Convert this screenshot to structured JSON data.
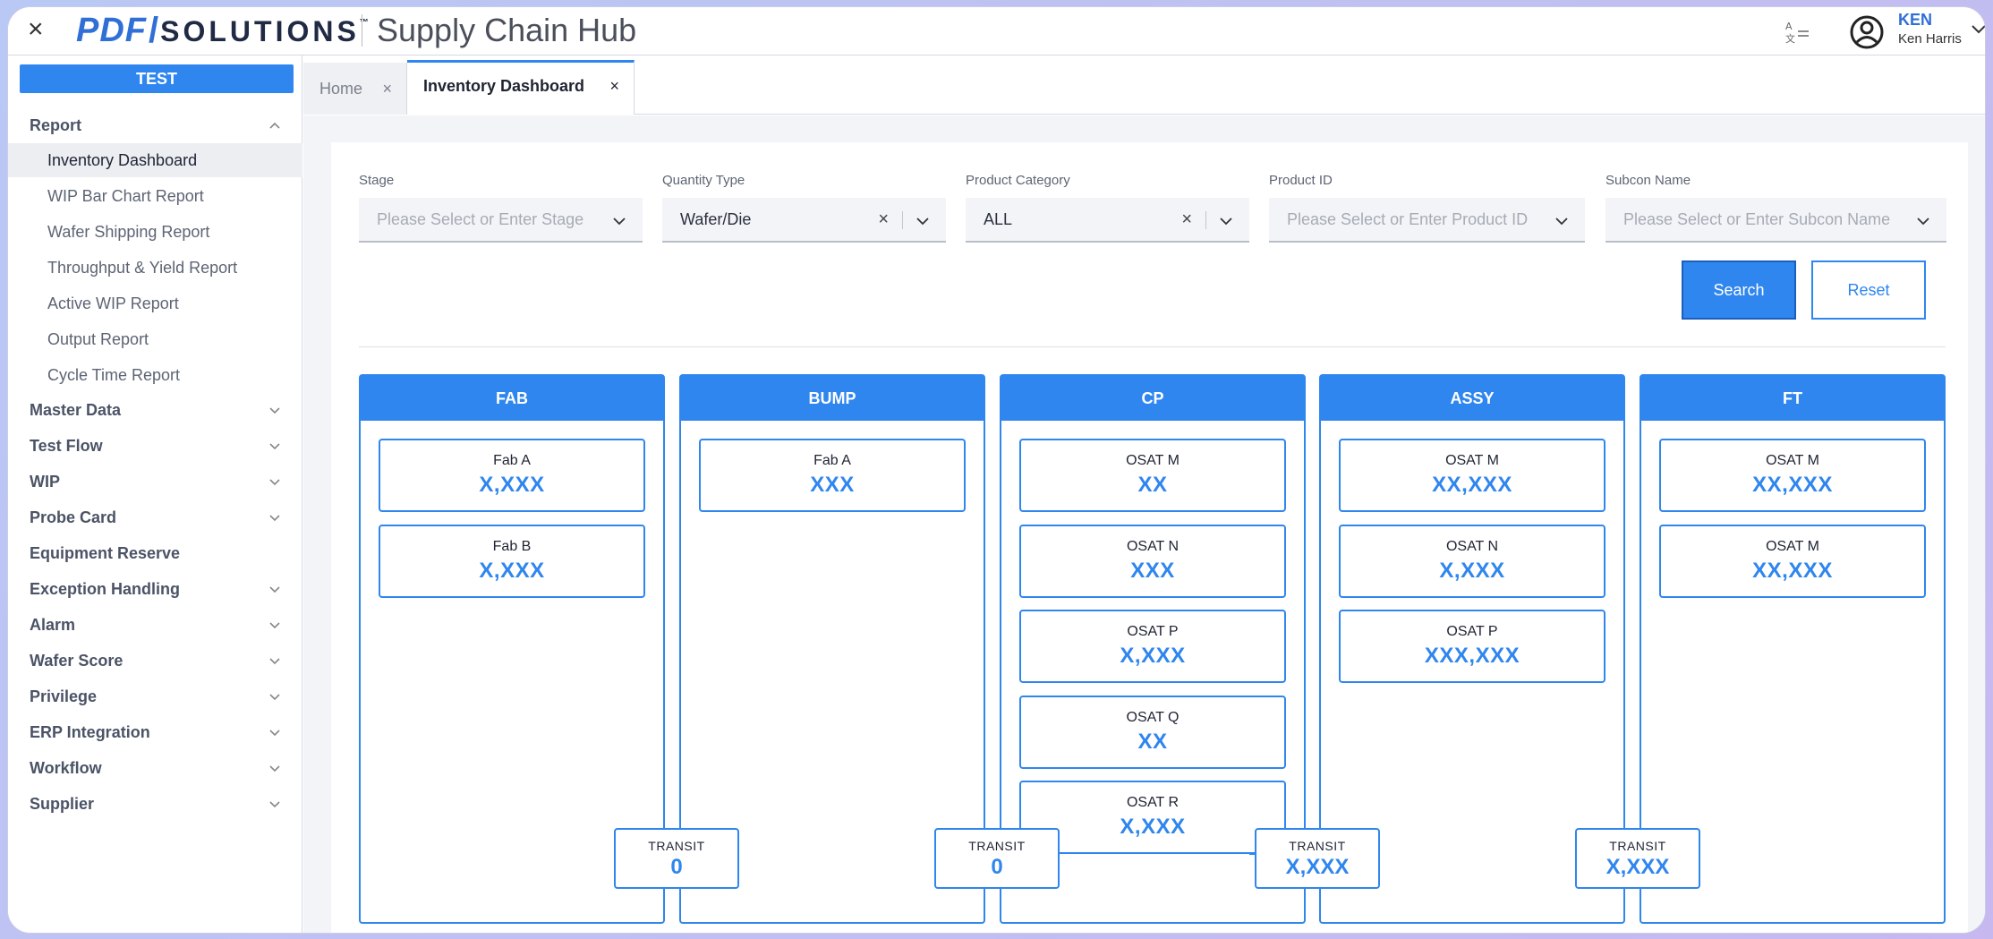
{
  "header": {
    "close_glyph": "×",
    "logo_pdf": "PDF",
    "logo_slash": "/",
    "logo_solutions": "SOLUTIONS",
    "logo_tm": "™",
    "app_title": "Supply Chain Hub",
    "user_short": "KEN",
    "user_full": "Ken Harris"
  },
  "sidebar": {
    "env_badge": "TEST",
    "report_section": "Report",
    "report_items": [
      "Inventory Dashboard",
      "WIP Bar Chart Report",
      "Wafer Shipping Report",
      "Throughput & Yield Report",
      "Active WIP Report",
      "Output Report",
      "Cycle Time Report"
    ],
    "sections": [
      "Master Data",
      "Test Flow",
      "WIP",
      "Probe Card",
      "Equipment Reserve",
      "Exception Handling",
      "Alarm",
      "Wafer Score",
      "Privilege",
      "ERP Integration",
      "Workflow",
      "Supplier"
    ]
  },
  "tabs": [
    {
      "label": "Home",
      "close": "×"
    },
    {
      "label": "Inventory Dashboard",
      "close": "×"
    }
  ],
  "filters": {
    "stage": {
      "label": "Stage",
      "placeholder": "Please Select or Enter Stage"
    },
    "quantity_type": {
      "label": "Quantity Type",
      "value": "Wafer/Die"
    },
    "product_category": {
      "label": "Product Category",
      "value": "ALL"
    },
    "product_id": {
      "label": "Product ID",
      "placeholder": "Please Select or Enter Product ID"
    },
    "subcon_name": {
      "label": "Subcon Name",
      "placeholder": "Please Select or Enter Subcon Name"
    },
    "clear_glyph": "×"
  },
  "buttons": {
    "search": "Search",
    "reset": "Reset"
  },
  "stages": [
    {
      "name": "FAB",
      "cards": [
        {
          "site": "Fab A",
          "qty": "X,XXX"
        },
        {
          "site": "Fab B",
          "qty": "X,XXX"
        }
      ]
    },
    {
      "name": "BUMP",
      "cards": [
        {
          "site": "Fab A",
          "qty": "XXX"
        }
      ]
    },
    {
      "name": "CP",
      "cards": [
        {
          "site": "OSAT M",
          "qty": "XX"
        },
        {
          "site": "OSAT N",
          "qty": "XXX"
        },
        {
          "site": "OSAT P",
          "qty": "X,XXX"
        },
        {
          "site": "OSAT Q",
          "qty": "XX"
        },
        {
          "site": "OSAT R",
          "qty": "X,XXX"
        }
      ]
    },
    {
      "name": "ASSY",
      "cards": [
        {
          "site": "OSAT M",
          "qty": "XX,XXX"
        },
        {
          "site": "OSAT N",
          "qty": "X,XXX"
        },
        {
          "site": "OSAT P",
          "qty": "XXX,XXX"
        }
      ]
    },
    {
      "name": "FT",
      "cards": [
        {
          "site": "OSAT M",
          "qty": "XX,XXX"
        },
        {
          "site": "OSAT M",
          "qty": "XX,XXX"
        }
      ]
    }
  ],
  "transits": [
    {
      "label": "TRANSIT",
      "value": "0"
    },
    {
      "label": "TRANSIT",
      "value": "0"
    },
    {
      "label": "TRANSIT",
      "value": "X,XXX"
    },
    {
      "label": "TRANSIT",
      "value": "X,XXX"
    }
  ],
  "colors": {
    "accent": "#2f86ee",
    "logo_blue": "#2f6fd6"
  }
}
